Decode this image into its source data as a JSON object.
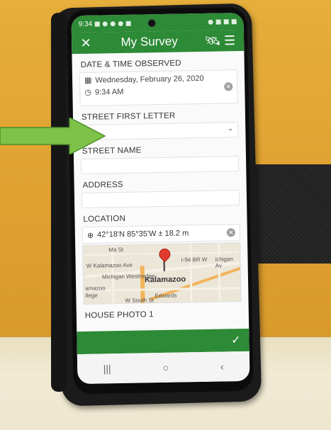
{
  "status_bar": {
    "time": "9:34"
  },
  "app_bar": {
    "close_icon": "close-icon",
    "title": "My Survey",
    "gps_icon": "satellite-icon",
    "menu_icon": "menu-icon"
  },
  "form": {
    "datetime": {
      "label": "DATE & TIME OBSERVED",
      "date": "Wednesday, February 26, 2020",
      "time": "9:34 AM"
    },
    "street_first_letter": {
      "label": "STREET FIRST LETTER",
      "value": ""
    },
    "street_name": {
      "label": "STREET NAME",
      "value": ""
    },
    "address": {
      "label": "ADDRESS",
      "value": ""
    },
    "location": {
      "label": "LOCATION",
      "coords": "42°18'N 85°35'W ± 18.2 m",
      "map": {
        "city": "Kalamazoo",
        "road_labels": [
          "W Kalamazoo Ave",
          "W South St",
          "Edwards",
          "ichigan Av",
          "I-94 BR W",
          "Ma St",
          "Michigan",
          "Westnedge",
          "amazoo",
          "Ilege"
        ]
      }
    },
    "next_label": "HOUSE PHOTO 1"
  },
  "nav": {
    "recents": "|||",
    "home": "○",
    "back": "‹"
  },
  "footer": {
    "submit_icon": "check-icon"
  },
  "colors": {
    "accent": "#2d8a36",
    "arrow": "#7ec24a"
  }
}
